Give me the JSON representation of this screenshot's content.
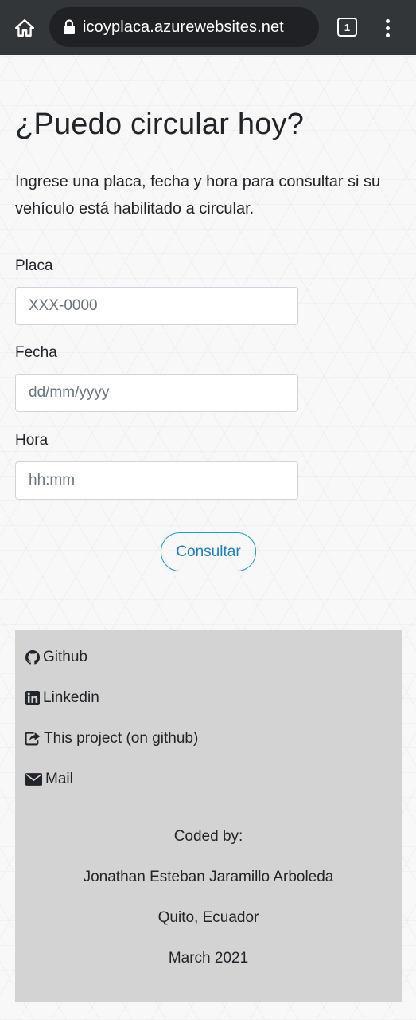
{
  "browser": {
    "url": "icoyplaca.azurewebsites.net",
    "tab_count": "1"
  },
  "page": {
    "title": "¿Puedo circular hoy?",
    "intro": "Ingrese una placa, fecha y hora para consultar si su vehículo está habilitado a circular."
  },
  "form": {
    "placa": {
      "label": "Placa",
      "placeholder": "XXX-0000"
    },
    "fecha": {
      "label": "Fecha",
      "placeholder": "dd/mm/yyyy"
    },
    "hora": {
      "label": "Hora",
      "placeholder": "hh:mm"
    },
    "submit_label": "Consultar"
  },
  "footer": {
    "links": [
      {
        "label": "Github",
        "icon": "github-icon"
      },
      {
        "label": "Linkedin",
        "icon": "linkedin-icon"
      },
      {
        "label": "This project (on github)",
        "icon": "share-icon"
      },
      {
        "label": "Mail",
        "icon": "envelope-icon"
      }
    ],
    "coded_by": "Coded by:",
    "author": "Jonathan Esteban Jaramillo Arboleda",
    "location": "Quito, Ecuador",
    "date": "March 2021"
  },
  "colors": {
    "browser_bar": "#323639",
    "url_pill": "#202124",
    "footer_bg": "#d3d3d3",
    "button_border": "#17a2b8",
    "button_text": "#1a7fc4"
  }
}
